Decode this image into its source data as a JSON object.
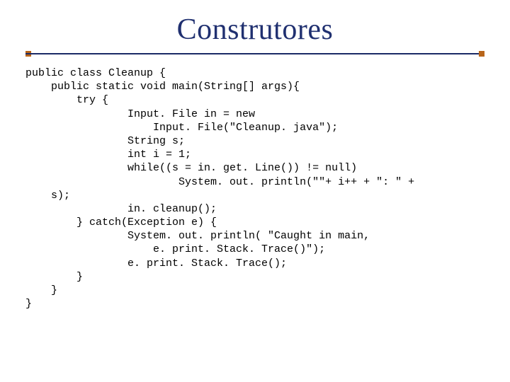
{
  "title": "Construtores",
  "code": "public class Cleanup {\n    public static void main(String[] args){\n        try {\n                Input. File in = new\n                    Input. File(\"Cleanup. java\");\n                String s;\n                int i = 1;\n                while((s = in. get. Line()) != null)\n                        System. out. println(\"\"+ i++ + \": \" +\n    s);\n                in. cleanup();\n        } catch(Exception e) {\n                System. out. println( \"Caught in main,\n                    e. print. Stack. Trace()\");\n                e. print. Stack. Trace();\n        }\n    }\n}"
}
